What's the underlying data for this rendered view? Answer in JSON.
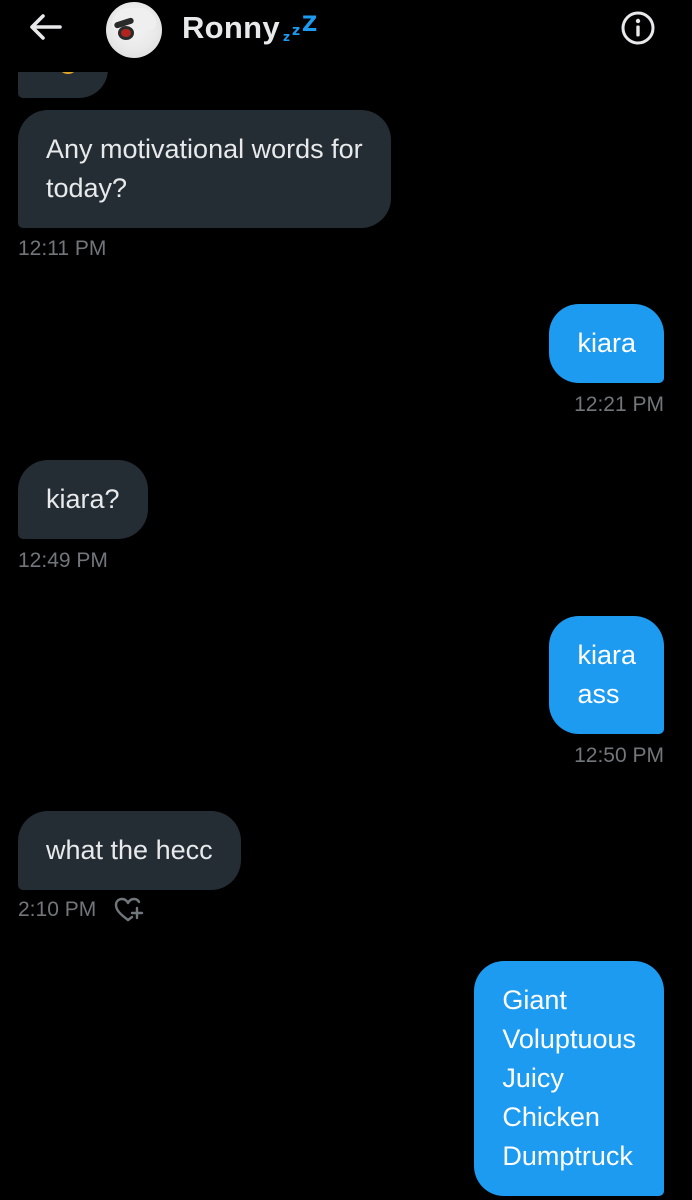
{
  "header": {
    "contact_name": "Ronny",
    "name_suffix_zzz": [
      "z",
      "z",
      "Z"
    ],
    "accent_color": "#1d9bf0",
    "icons": {
      "back": "arrow-left-icon",
      "info": "info-circle-icon"
    }
  },
  "messages": [
    {
      "direction": "incoming",
      "lines": [
        "Any motivational words for",
        "today?"
      ],
      "time": "12:11 PM"
    },
    {
      "direction": "outgoing",
      "lines": [
        "kiara"
      ],
      "time": "12:21 PM"
    },
    {
      "direction": "incoming",
      "lines": [
        "kiara?"
      ],
      "time": "12:49 PM"
    },
    {
      "direction": "outgoing",
      "lines": [
        "kiara",
        "ass"
      ],
      "time": "12:50 PM"
    },
    {
      "direction": "incoming",
      "lines": [
        "what the hecc"
      ],
      "time": "2:10 PM",
      "reaction_icon": "heart-plus-icon"
    },
    {
      "direction": "outgoing",
      "lines": [
        "Giant",
        "Voluptuous",
        "Juicy",
        "Chicken",
        "Dumptruck"
      ]
    }
  ],
  "colors": {
    "background": "#000000",
    "incoming_bubble": "#252d34",
    "outgoing_bubble": "#1d9bf0",
    "timestamp": "#71767b"
  }
}
